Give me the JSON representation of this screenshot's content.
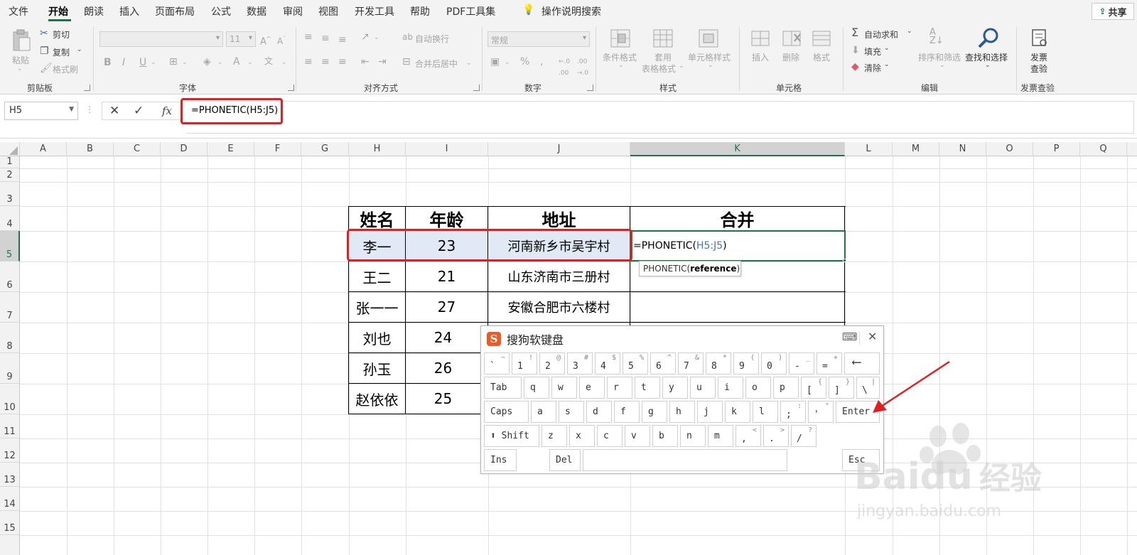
{
  "menu": {
    "tabs": [
      "文件",
      "开始",
      "朗读",
      "插入",
      "页面布局",
      "公式",
      "数据",
      "审阅",
      "视图",
      "开发工具",
      "帮助",
      "PDF工具集"
    ],
    "search_label": "操作说明搜索",
    "share_label": "共享",
    "active_tab": "开始"
  },
  "ribbon": {
    "clipboard": {
      "paste": "粘贴",
      "cut": "剪切",
      "copy": "复制",
      "format_painter": "格式刷",
      "label": "剪贴板"
    },
    "font": {
      "font_size": "11",
      "label": "字体"
    },
    "alignment": {
      "wrap_text": "自动换行",
      "merge_center": "合并后居中",
      "label": "对齐方式"
    },
    "number": {
      "format": "常规",
      "label": "数字"
    },
    "styles": {
      "conditional": "条件格式",
      "table_format_1": "套用",
      "table_format_2": "表格格式",
      "cell_styles": "单元格样式",
      "label": "样式"
    },
    "cells": {
      "insert": "插入",
      "delete": "删除",
      "format": "格式",
      "label": "单元格"
    },
    "editing": {
      "autosum": "自动求和",
      "fill": "填充",
      "clear": "清除",
      "sort_filter": "排序和筛选",
      "find_select": "查找和选择",
      "label": "编辑"
    },
    "invoice": {
      "btn_1": "发票",
      "btn_2": "查验",
      "label": "发票查验"
    }
  },
  "formula_bar": {
    "name_box": "H5",
    "formula": "=PHONETIC(H5:J5)"
  },
  "sheet": {
    "columns": [
      "A",
      "B",
      "C",
      "D",
      "E",
      "F",
      "G",
      "H",
      "I",
      "J",
      "K",
      "L",
      "M",
      "N",
      "O",
      "P",
      "Q"
    ],
    "selected_column": "K",
    "rows": [
      "1",
      "2",
      "3",
      "4",
      "5",
      "6",
      "7",
      "8",
      "9",
      "10",
      "11",
      "12",
      "13",
      "14",
      "15"
    ],
    "selected_row": "5",
    "table": {
      "headers": [
        "姓名",
        "年龄",
        "地址",
        "合并"
      ],
      "rows": [
        [
          "李一",
          "23",
          "河南新乡市吴宇村"
        ],
        [
          "王二",
          "21",
          "山东济南市三册村"
        ],
        [
          "张一一",
          "27",
          "安徽合肥市六楼村"
        ],
        [
          "刘也",
          "24",
          ""
        ],
        [
          "孙玉",
          "26",
          ""
        ],
        [
          "赵依依",
          "25",
          ""
        ]
      ]
    },
    "edit_cell": {
      "prefix": "=PHONETIC(",
      "ref": "H5:J5",
      "suffix": ")"
    },
    "tooltip": {
      "fn": "PHONETIC(",
      "arg": "reference",
      "close": ")"
    }
  },
  "keyboard": {
    "title": "搜狗软键盘",
    "row1": [
      [
        "`",
        "~"
      ],
      [
        "1",
        "!"
      ],
      [
        "2",
        "@"
      ],
      [
        "3",
        "#"
      ],
      [
        "4",
        "$"
      ],
      [
        "5",
        "%"
      ],
      [
        "6",
        "^"
      ],
      [
        "7",
        "&"
      ],
      [
        "8",
        "*"
      ],
      [
        "9",
        "("
      ],
      [
        "0",
        ")"
      ],
      [
        "-",
        "_"
      ],
      [
        "=",
        "+"
      ]
    ],
    "row2_keys": [
      "q",
      "w",
      "e",
      "r",
      "t",
      "y",
      "u",
      "i",
      "o",
      "p"
    ],
    "row2_extra": [
      [
        "[",
        "{"
      ],
      [
        "]",
        "}"
      ],
      [
        "\\",
        "|"
      ]
    ],
    "row3_keys": [
      "a",
      "s",
      "d",
      "f",
      "g",
      "h",
      "j",
      "k",
      "l"
    ],
    "row3_extra": [
      [
        ";",
        ":"
      ],
      [
        "'",
        "\""
      ]
    ],
    "row4_keys": [
      "z",
      "x",
      "c",
      "v",
      "b",
      "n",
      "m"
    ],
    "row4_extra": [
      [
        ",",
        "<"
      ],
      [
        ".",
        ">"
      ],
      [
        "/",
        "?"
      ]
    ],
    "tab": "Tab",
    "caps": "Caps",
    "shift": "⬆ Shift",
    "enter": "Enter",
    "ins": "Ins",
    "del": "Del",
    "esc": "Esc",
    "backspace": "⟵"
  },
  "watermark": {
    "brand": "Baidu",
    "product": "经验",
    "url": "jingyan.baidu.com"
  }
}
